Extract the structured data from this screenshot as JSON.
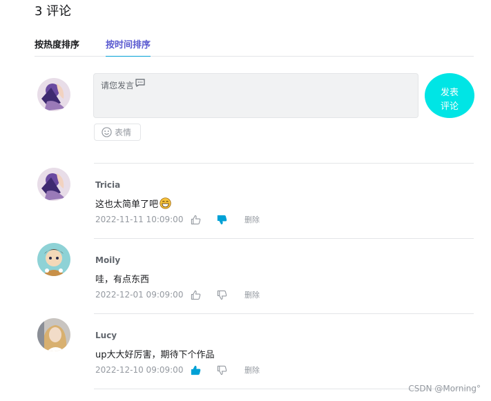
{
  "header": {
    "count_label": "3 评论"
  },
  "tabs": [
    {
      "label": "按热度排序",
      "active": false
    },
    {
      "label": "按时间排序",
      "active": true
    }
  ],
  "composer": {
    "placeholder": "请您发言",
    "submit_label_line1": "发表",
    "submit_label_line2": "评论",
    "emoji_label": "表情"
  },
  "comments": [
    {
      "name": "Tricia",
      "text": "这也太简单了吧",
      "time": "2022-11-11 10:09:00",
      "liked": false,
      "disliked": true,
      "delete_label": "删除",
      "has_emoji": true
    },
    {
      "name": "Moily",
      "text": "哇，有点东西",
      "time": "2022-12-01 09:09:00",
      "liked": false,
      "disliked": false,
      "delete_label": "删除",
      "has_emoji": false
    },
    {
      "name": "Lucy",
      "text": "up大大好厉害，期待下个作品",
      "time": "2022-12-10 09:09:00",
      "liked": true,
      "disliked": false,
      "delete_label": "删除",
      "has_emoji": false
    }
  ],
  "watermark": "CSDN @Morning°",
  "colors": {
    "active_tab": "#5a5ad0",
    "tab_underline": "#00a1d6",
    "submit_bg": "#00e5e5",
    "action_active": "#00a1d6",
    "action_inactive": "#9499a0"
  },
  "icons": {
    "composer": "chat-bubble-icon",
    "emoji": "smiley-icon",
    "like": "thumbs-up-icon",
    "dislike": "thumbs-down-icon"
  }
}
